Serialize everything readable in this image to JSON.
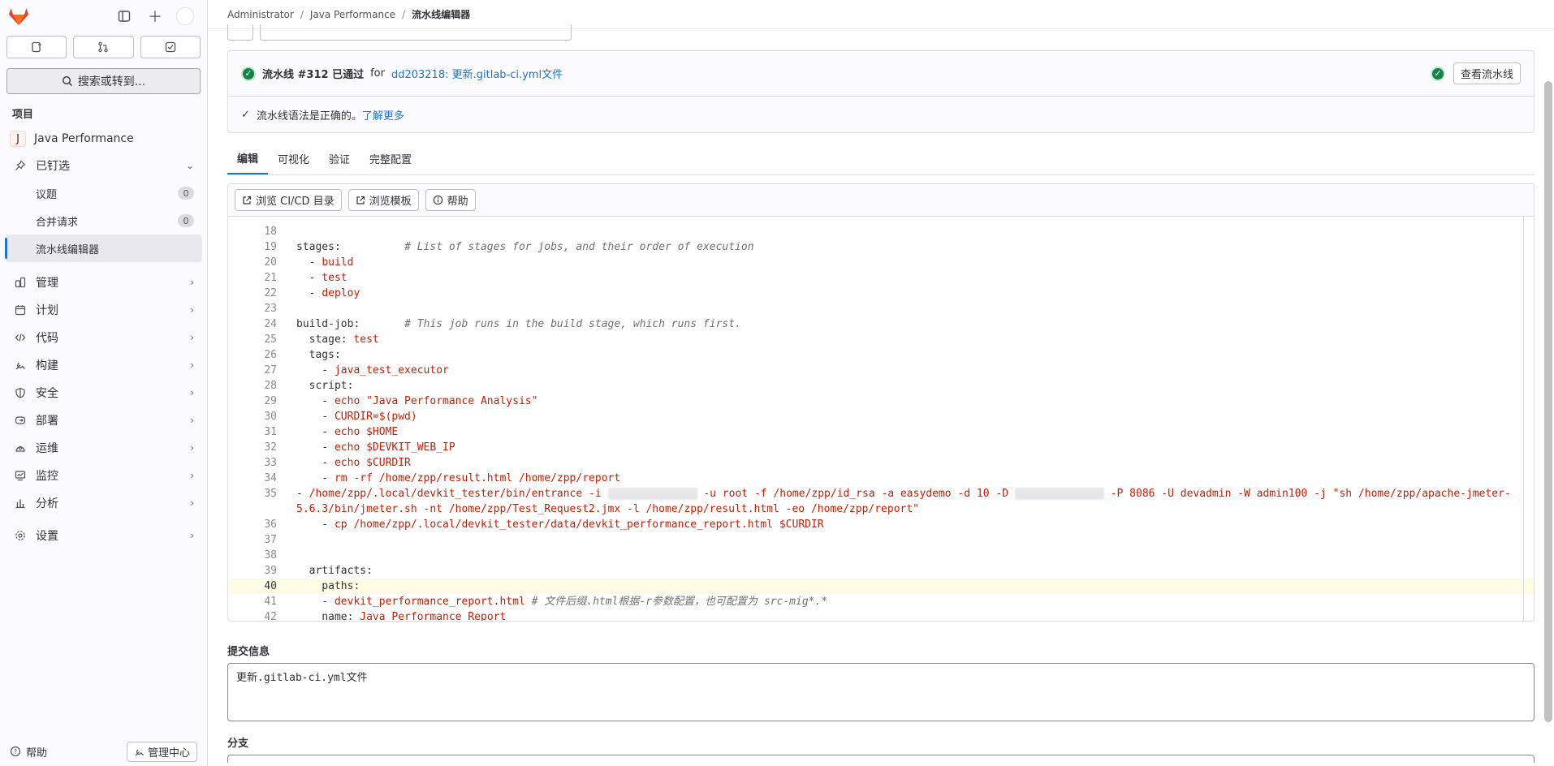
{
  "sidebar": {
    "counts": [
      {
        "icon": "issues-icon"
      },
      {
        "icon": "merge-request-icon"
      },
      {
        "icon": "todo-icon"
      }
    ],
    "search_label": "搜索或转到...",
    "section_title": "项目",
    "project": {
      "avatar_letter": "J",
      "name": "Java Performance"
    },
    "pinned": {
      "label": "已钉选"
    },
    "pinned_items": [
      {
        "label": "议题",
        "count": "0"
      },
      {
        "label": "合并请求",
        "count": "0"
      },
      {
        "label": "流水线编辑器"
      }
    ],
    "nav": [
      {
        "label": "管理",
        "icon": "admin-icon"
      },
      {
        "label": "计划",
        "icon": "plan-icon"
      },
      {
        "label": "代码",
        "icon": "code-icon"
      },
      {
        "label": "构建",
        "icon": "build-icon"
      },
      {
        "label": "安全",
        "icon": "shield-icon"
      },
      {
        "label": "部署",
        "icon": "deploy-icon"
      },
      {
        "label": "运维",
        "icon": "operate-icon"
      },
      {
        "label": "监控",
        "icon": "monitor-icon"
      },
      {
        "label": "分析",
        "icon": "analytics-icon"
      }
    ],
    "settings_label": "设置",
    "help_label": "帮助",
    "admin_label": "管理中心"
  },
  "breadcrumb": {
    "items": [
      "Administrator",
      "Java Performance",
      "流水线编辑器"
    ]
  },
  "status": {
    "pipeline_text": "流水线 #312 已通过",
    "for_text": "for",
    "commit_link": "dd203218: 更新.gitlab-ci.yml文件",
    "view_button": "查看流水线",
    "lint_text": "流水线语法是正确的。",
    "learn_more": "了解更多"
  },
  "tabs": [
    "编辑",
    "可视化",
    "验证",
    "完整配置"
  ],
  "toolbar": {
    "browse_catalog": "浏览 CI/CD 目录",
    "browse_templates": "浏览模板",
    "help": "帮助"
  },
  "code_lines": [
    {
      "n": "18",
      "parts": []
    },
    {
      "n": "19",
      "parts": [
        {
          "c": "kw",
          "t": "stages:          "
        },
        {
          "c": "cmt",
          "t": "# List of stages for jobs, and their order of execution"
        }
      ]
    },
    {
      "n": "20",
      "parts": [
        {
          "c": "kw",
          "t": "  - "
        },
        {
          "c": "str",
          "t": "build"
        }
      ]
    },
    {
      "n": "21",
      "parts": [
        {
          "c": "kw",
          "t": "  - "
        },
        {
          "c": "str",
          "t": "test"
        }
      ]
    },
    {
      "n": "22",
      "parts": [
        {
          "c": "kw",
          "t": "  - "
        },
        {
          "c": "str",
          "t": "deploy"
        }
      ]
    },
    {
      "n": "23",
      "parts": []
    },
    {
      "n": "24",
      "parts": [
        {
          "c": "kw",
          "t": "build-job:       "
        },
        {
          "c": "cmt",
          "t": "# This job runs in the build stage, which runs first."
        }
      ]
    },
    {
      "n": "25",
      "parts": [
        {
          "c": "kw",
          "t": "  stage: "
        },
        {
          "c": "str",
          "t": "test"
        }
      ]
    },
    {
      "n": "26",
      "parts": [
        {
          "c": "kw",
          "t": "  tags:"
        }
      ]
    },
    {
      "n": "27",
      "parts": [
        {
          "c": "kw",
          "t": "    - "
        },
        {
          "c": "str",
          "t": "java_test_executor"
        }
      ]
    },
    {
      "n": "28",
      "parts": [
        {
          "c": "kw",
          "t": "  script:"
        }
      ]
    },
    {
      "n": "29",
      "parts": [
        {
          "c": "kw",
          "t": "    - "
        },
        {
          "c": "str",
          "t": "echo \"Java Performance Analysis\""
        }
      ]
    },
    {
      "n": "30",
      "parts": [
        {
          "c": "kw",
          "t": "    - "
        },
        {
          "c": "str",
          "t": "CURDIR=$(pwd)"
        }
      ]
    },
    {
      "n": "31",
      "parts": [
        {
          "c": "kw",
          "t": "    - "
        },
        {
          "c": "str",
          "t": "echo $HOME"
        }
      ]
    },
    {
      "n": "32",
      "parts": [
        {
          "c": "kw",
          "t": "    - "
        },
        {
          "c": "str",
          "t": "echo $DEVKIT_WEB_IP"
        }
      ]
    },
    {
      "n": "33",
      "parts": [
        {
          "c": "kw",
          "t": "    - "
        },
        {
          "c": "str",
          "t": "echo $CURDIR"
        }
      ]
    },
    {
      "n": "34",
      "parts": [
        {
          "c": "kw",
          "t": "    - "
        },
        {
          "c": "str",
          "t": "rm -rf /home/zpp/result.html /home/zpp/report"
        }
      ]
    },
    {
      "n": "35",
      "wrap": true,
      "parts": [
        {
          "c": "kw",
          "t": "    - "
        },
        {
          "c": "str",
          "t": "/home/zpp/.local/devkit_tester/bin/entrance  -i "
        },
        {
          "c": "blur",
          "t": ""
        },
        {
          "c": "str",
          "t": " -u root -f /home/zpp/id_rsa -a easydemo -d 10 -D "
        },
        {
          "c": "blur",
          "t": ""
        },
        {
          "c": "str",
          "t": " -P 8086 -U devadmin -W admin100 -j \"sh /home/zpp/apache-jmeter-5.6.3/bin/jmeter.sh -nt /home/zpp/Test_Request2.jmx -l /home/zpp/result.html -eo /home/zpp/report\""
        }
      ]
    },
    {
      "n": "36",
      "parts": [
        {
          "c": "kw",
          "t": "    - "
        },
        {
          "c": "str",
          "t": "cp /home/zpp/.local/devkit_tester/data/devkit_performance_report.html $CURDIR"
        }
      ]
    },
    {
      "n": "37",
      "parts": []
    },
    {
      "n": "38",
      "parts": []
    },
    {
      "n": "39",
      "parts": [
        {
          "c": "kw",
          "t": "  artifacts:"
        }
      ]
    },
    {
      "n": "40",
      "cur": true,
      "parts": [
        {
          "c": "kw",
          "t": "    paths:"
        }
      ]
    },
    {
      "n": "41",
      "parts": [
        {
          "c": "kw",
          "t": "    - "
        },
        {
          "c": "str",
          "t": "devkit_performance_report.html"
        },
        {
          "c": "cmt",
          "t": " # 文件后缀.html根据-r参数配置，也可配置为 src-mig*.*"
        }
      ]
    },
    {
      "n": "42",
      "parts": [
        {
          "c": "kw",
          "t": "    name: "
        },
        {
          "c": "str",
          "t": "Java_Performance_Report"
        }
      ]
    }
  ],
  "commit": {
    "label": "提交信息",
    "value": "更新.gitlab-ci.yml文件"
  },
  "branch": {
    "label": "分支"
  }
}
